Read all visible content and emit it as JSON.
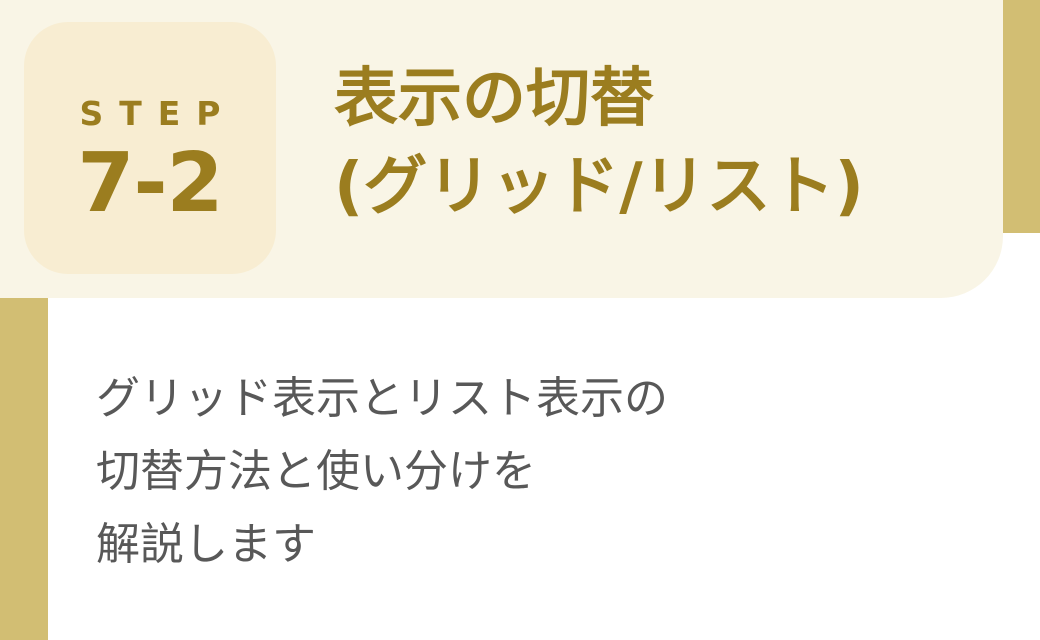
{
  "step": {
    "label": "STEP",
    "number": "7-2"
  },
  "title": {
    "line1": "表示の切替",
    "line2": "(グリッド/リスト)"
  },
  "description": {
    "lines": [
      "グリッド表示とリスト表示の",
      "切替方法と使い分けを",
      "解説します"
    ]
  },
  "colors": {
    "accent_gold": "#d2be73",
    "title_gold": "#9b7d1f",
    "header_cream": "#f9f5e6",
    "badge_cream": "#f8edd2",
    "body_text": "#585858"
  }
}
